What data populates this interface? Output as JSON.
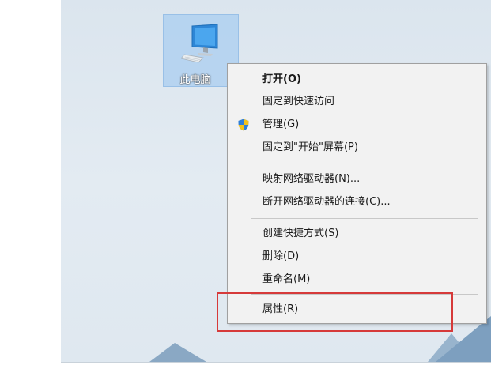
{
  "desktop": {
    "icon_label": "此电脑",
    "icon_name": "computer-icon"
  },
  "context_menu": {
    "items": [
      {
        "label": "打开(O)",
        "bold": true
      },
      {
        "label": "固定到快速访问"
      },
      {
        "label": "管理(G)",
        "icon": "shield-icon"
      },
      {
        "label": "固定到\"开始\"屏幕(P)"
      },
      {
        "label": "映射网络驱动器(N)..."
      },
      {
        "label": "断开网络驱动器的连接(C)..."
      },
      {
        "label": "创建快捷方式(S)"
      },
      {
        "label": "删除(D)"
      },
      {
        "label": "重命名(M)"
      },
      {
        "label": "属性(R)"
      }
    ]
  },
  "colors": {
    "highlight_border": "#d63a3a",
    "menu_background": "#f2f2f2",
    "selection": "#aacdf0"
  }
}
